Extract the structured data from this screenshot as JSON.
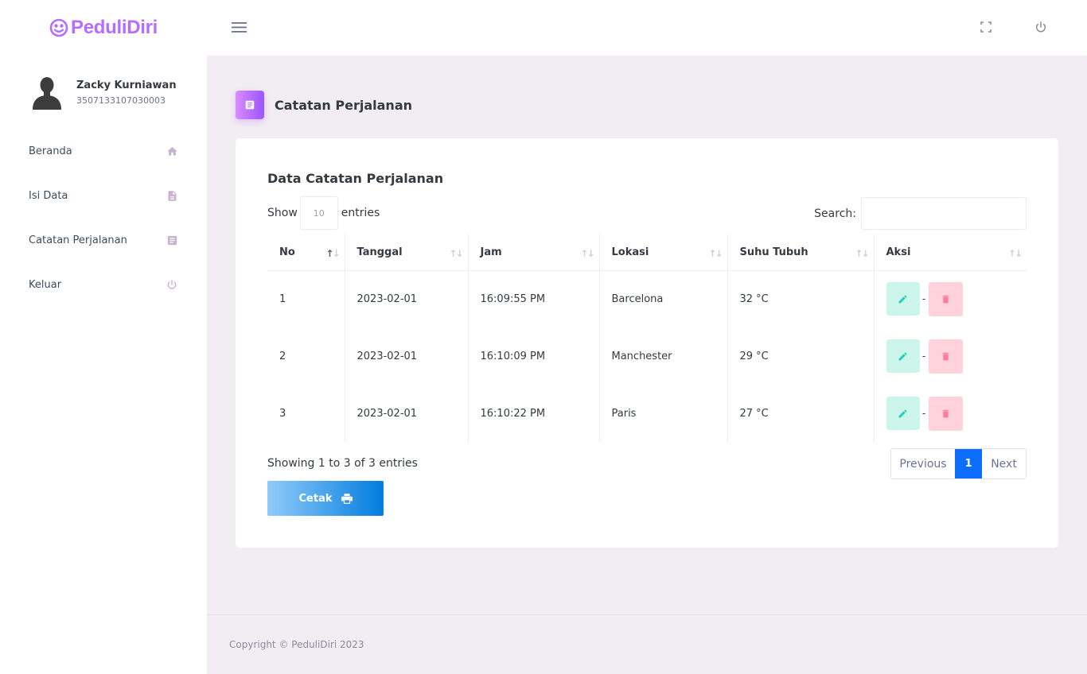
{
  "brand": {
    "name": "PeduliDiri",
    "color": "#b66dff"
  },
  "user": {
    "name": "Zacky Kurniawan",
    "nik": "3507133107030003"
  },
  "nav": [
    {
      "label": "Beranda",
      "icon": "home-icon"
    },
    {
      "label": "Isi Data",
      "icon": "file-document-icon"
    },
    {
      "label": "Catatan Perjalanan",
      "icon": "notes-icon"
    },
    {
      "label": "Keluar",
      "icon": "power-icon"
    }
  ],
  "page": {
    "title": "Catatan Perjalanan"
  },
  "card": {
    "title": "Data Catatan Perjalanan",
    "length": {
      "show": "Show",
      "value": "10",
      "entries": "entries"
    },
    "search": {
      "label": "Search:"
    }
  },
  "table": {
    "columns": [
      "No",
      "Tanggal",
      "Jam",
      "Lokasi",
      "Suhu Tubuh",
      "Aksi"
    ],
    "rows": [
      {
        "no": "1",
        "tanggal": "2023-02-01",
        "jam": "16:09:55 PM",
        "lokasi": "Barcelona",
        "suhu": "32 °C"
      },
      {
        "no": "2",
        "tanggal": "2023-02-01",
        "jam": "16:10:09 PM",
        "lokasi": "Manchester",
        "suhu": "29 °C"
      },
      {
        "no": "3",
        "tanggal": "2023-02-01",
        "jam": "16:10:22 PM",
        "lokasi": "Paris",
        "suhu": "27 °C"
      }
    ],
    "separator": "-"
  },
  "info": "Showing 1 to 3 of 3 entries",
  "pagination": {
    "previous": "Previous",
    "current": "1",
    "next": "Next"
  },
  "print_button": {
    "label": "Cetak",
    "icon": "printer-icon"
  },
  "footer": {
    "text": "Copyright © PeduliDiri 2023"
  },
  "colors": {
    "accent": "#b66dff",
    "edit_bg": "#cdf5ec",
    "edit_icon": "#1bcfb4",
    "delete_bg": "#ffd2dc",
    "delete_icon": "#fe7c96",
    "page_active": "#0d6efd"
  }
}
